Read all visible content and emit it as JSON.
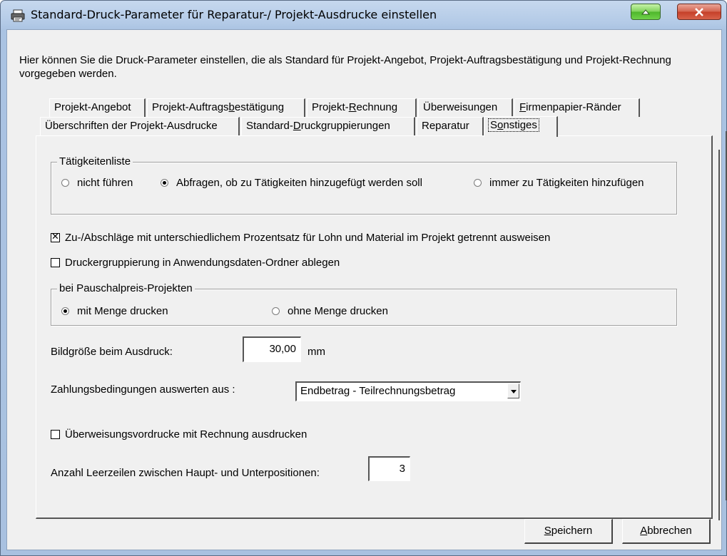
{
  "window": {
    "title": "Standard-Druck-Parameter für Reparatur-/ Projekt-Ausdrucke einstellen"
  },
  "description": "Hier können Sie die Druck-Parameter einstellen, die als Standard für Projekt-Angebot, Projekt-Auftragsbestätigung und Projekt-Rechnung vorgegeben werden.",
  "tabs_row1": [
    {
      "label": "Projekt-Angebot"
    },
    {
      "pre": "Projekt-Auftrags",
      "key": "b",
      "post": "estätigung"
    },
    {
      "pre": "Projekt-",
      "key": "R",
      "post": "echnung"
    },
    {
      "label": "Überweisungen"
    },
    {
      "pre": "",
      "key": "F",
      "post": "irmenpapier-Ränder"
    }
  ],
  "tabs_row2": [
    {
      "label": "Überschriften der Projekt-Ausdrucke"
    },
    {
      "pre": "Standard-",
      "key": "D",
      "post": "ruckgruppierungen"
    },
    {
      "label": "Reparatur"
    },
    {
      "pre": "S",
      "key": "o",
      "post": "nstiges",
      "active": true
    }
  ],
  "taetigkeiten": {
    "title": "Tätigkeitenliste",
    "options": [
      "nicht führen",
      "Abfragen, ob zu Tätigkeiten hinzugefügt werden soll",
      "immer zu Tätigkeiten hinzufügen"
    ],
    "selected_index": 1
  },
  "check_zuabschlaege": {
    "label": "Zu-/Abschläge mit unterschiedlichem Prozentsatz für Lohn und Material im Projekt getrennt ausweisen",
    "checked": true
  },
  "check_druckergruppierung": {
    "label": "Druckergruppierung in Anwendungsdaten-Ordner ablegen",
    "checked": false
  },
  "pauschal": {
    "title": "bei Pauschalpreis-Projekten",
    "options": [
      "mit Menge drucken",
      "ohne Menge drucken"
    ],
    "selected_index": 0
  },
  "bildgroesse": {
    "label": "Bildgröße beim Ausdruck:",
    "value": "30,00",
    "unit": "mm"
  },
  "zahlung": {
    "label": "Zahlungsbedingungen auswerten aus :",
    "selected": "Endbetrag - Teilrechnungsbetrag"
  },
  "check_ueberweisung": {
    "label": "Überweisungsvordrucke mit Rechnung ausdrucken",
    "checked": false
  },
  "leerzeilen": {
    "label": "Anzahl Leerzeilen zwischen Haupt- und Unterpositionen:",
    "value": "3"
  },
  "buttons": {
    "save": {
      "key": "S",
      "post": "peichern"
    },
    "cancel": {
      "key": "A",
      "post": "bbrechen"
    }
  }
}
